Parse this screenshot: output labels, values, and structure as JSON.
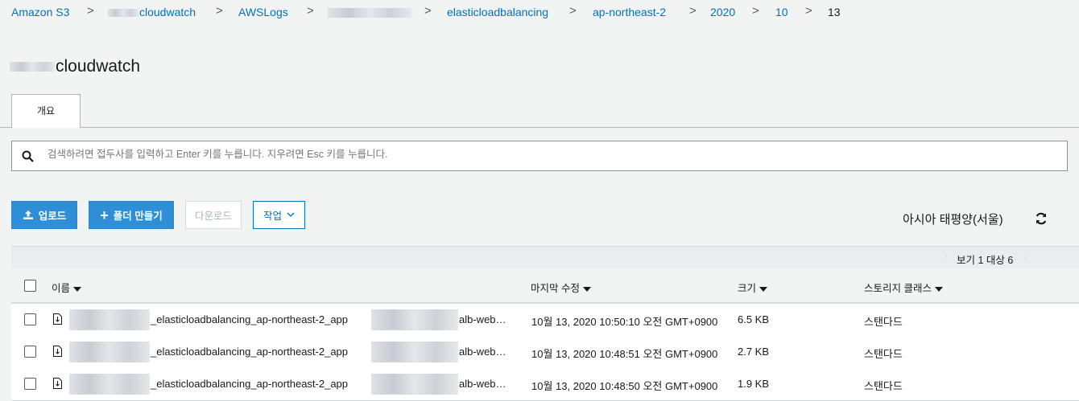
{
  "breadcrumb": {
    "items": [
      "Amazon S3",
      "cloudwatch",
      "AWSLogs",
      "",
      "elasticloadbalancing",
      "ap-northeast-2",
      "2020",
      "10",
      "13"
    ],
    "separator": ">"
  },
  "bucket_title": "cloudwatch",
  "tabs": [
    {
      "label": "개요"
    }
  ],
  "search": {
    "placeholder": "검색하려면 접두사를 입력하고 Enter 키를 누릅니다. 지우려면 Esc 키를 누릅니다."
  },
  "toolbar": {
    "upload_label": "업로드",
    "create_folder_label": "폴더 만들기",
    "download_label": "다운로드",
    "actions_label": "작업",
    "region": "아시아 태평양(서울)"
  },
  "pager": {
    "text": "보기 1 대상 6"
  },
  "table": {
    "columns": [
      "이름",
      "마지막 수정",
      "크기",
      "스토리지 클래스"
    ],
    "rows": [
      {
        "name_mid": "_elasticloadbalancing_ap-northeast-2_app",
        "name_end": "alb-web…",
        "modified": "10월 13, 2020 10:50:10 오전 GMT+0900",
        "size": "6.5 KB",
        "storage": "스탠다드"
      },
      {
        "name_mid": "_elasticloadbalancing_ap-northeast-2_app",
        "name_end": "alb-web…",
        "modified": "10월 13, 2020 10:48:51 오전 GMT+0900",
        "size": "2.7 KB",
        "storage": "스탠다드"
      },
      {
        "name_mid": "_elasticloadbalancing_ap-northeast-2_app",
        "name_end": "alb-web…",
        "modified": "10월 13, 2020 10:48:50 오전 GMT+0900",
        "size": "1.9 KB",
        "storage": "스탠다드"
      }
    ]
  },
  "colors": {
    "link": "#0073bb",
    "primary": "#2e8fd6",
    "background": "#f2f3f3"
  },
  "icons": [
    "search-icon",
    "upload-icon",
    "plus-icon",
    "chevron-down-icon",
    "refresh-icon",
    "file-icon",
    "sort-caret-icon"
  ]
}
